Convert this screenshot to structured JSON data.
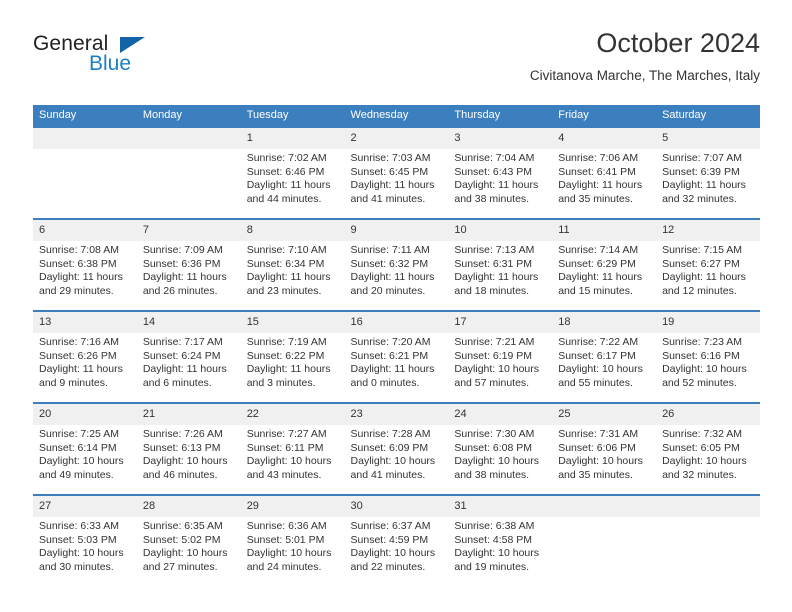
{
  "brand": {
    "name_part1": "General",
    "name_part2": "Blue",
    "accent_color": "#1363a8",
    "text_color": "#231f20"
  },
  "header": {
    "title": "October 2024",
    "subtitle": "Civitanova Marche, The Marches, Italy"
  },
  "calendar": {
    "header_bg": "#3c7fbf",
    "daynum_bg": "#f0f0f0",
    "weekdays": [
      "Sunday",
      "Monday",
      "Tuesday",
      "Wednesday",
      "Thursday",
      "Friday",
      "Saturday"
    ],
    "weeks": [
      [
        {
          "day": "",
          "lines": []
        },
        {
          "day": "",
          "lines": []
        },
        {
          "day": "1",
          "lines": [
            "Sunrise: 7:02 AM",
            "Sunset: 6:46 PM",
            "Daylight: 11 hours",
            "and 44 minutes."
          ]
        },
        {
          "day": "2",
          "lines": [
            "Sunrise: 7:03 AM",
            "Sunset: 6:45 PM",
            "Daylight: 11 hours",
            "and 41 minutes."
          ]
        },
        {
          "day": "3",
          "lines": [
            "Sunrise: 7:04 AM",
            "Sunset: 6:43 PM",
            "Daylight: 11 hours",
            "and 38 minutes."
          ]
        },
        {
          "day": "4",
          "lines": [
            "Sunrise: 7:06 AM",
            "Sunset: 6:41 PM",
            "Daylight: 11 hours",
            "and 35 minutes."
          ]
        },
        {
          "day": "5",
          "lines": [
            "Sunrise: 7:07 AM",
            "Sunset: 6:39 PM",
            "Daylight: 11 hours",
            "and 32 minutes."
          ]
        }
      ],
      [
        {
          "day": "6",
          "lines": [
            "Sunrise: 7:08 AM",
            "Sunset: 6:38 PM",
            "Daylight: 11 hours",
            "and 29 minutes."
          ]
        },
        {
          "day": "7",
          "lines": [
            "Sunrise: 7:09 AM",
            "Sunset: 6:36 PM",
            "Daylight: 11 hours",
            "and 26 minutes."
          ]
        },
        {
          "day": "8",
          "lines": [
            "Sunrise: 7:10 AM",
            "Sunset: 6:34 PM",
            "Daylight: 11 hours",
            "and 23 minutes."
          ]
        },
        {
          "day": "9",
          "lines": [
            "Sunrise: 7:11 AM",
            "Sunset: 6:32 PM",
            "Daylight: 11 hours",
            "and 20 minutes."
          ]
        },
        {
          "day": "10",
          "lines": [
            "Sunrise: 7:13 AM",
            "Sunset: 6:31 PM",
            "Daylight: 11 hours",
            "and 18 minutes."
          ]
        },
        {
          "day": "11",
          "lines": [
            "Sunrise: 7:14 AM",
            "Sunset: 6:29 PM",
            "Daylight: 11 hours",
            "and 15 minutes."
          ]
        },
        {
          "day": "12",
          "lines": [
            "Sunrise: 7:15 AM",
            "Sunset: 6:27 PM",
            "Daylight: 11 hours",
            "and 12 minutes."
          ]
        }
      ],
      [
        {
          "day": "13",
          "lines": [
            "Sunrise: 7:16 AM",
            "Sunset: 6:26 PM",
            "Daylight: 11 hours",
            "and 9 minutes."
          ]
        },
        {
          "day": "14",
          "lines": [
            "Sunrise: 7:17 AM",
            "Sunset: 6:24 PM",
            "Daylight: 11 hours",
            "and 6 minutes."
          ]
        },
        {
          "day": "15",
          "lines": [
            "Sunrise: 7:19 AM",
            "Sunset: 6:22 PM",
            "Daylight: 11 hours",
            "and 3 minutes."
          ]
        },
        {
          "day": "16",
          "lines": [
            "Sunrise: 7:20 AM",
            "Sunset: 6:21 PM",
            "Daylight: 11 hours",
            "and 0 minutes."
          ]
        },
        {
          "day": "17",
          "lines": [
            "Sunrise: 7:21 AM",
            "Sunset: 6:19 PM",
            "Daylight: 10 hours",
            "and 57 minutes."
          ]
        },
        {
          "day": "18",
          "lines": [
            "Sunrise: 7:22 AM",
            "Sunset: 6:17 PM",
            "Daylight: 10 hours",
            "and 55 minutes."
          ]
        },
        {
          "day": "19",
          "lines": [
            "Sunrise: 7:23 AM",
            "Sunset: 6:16 PM",
            "Daylight: 10 hours",
            "and 52 minutes."
          ]
        }
      ],
      [
        {
          "day": "20",
          "lines": [
            "Sunrise: 7:25 AM",
            "Sunset: 6:14 PM",
            "Daylight: 10 hours",
            "and 49 minutes."
          ]
        },
        {
          "day": "21",
          "lines": [
            "Sunrise: 7:26 AM",
            "Sunset: 6:13 PM",
            "Daylight: 10 hours",
            "and 46 minutes."
          ]
        },
        {
          "day": "22",
          "lines": [
            "Sunrise: 7:27 AM",
            "Sunset: 6:11 PM",
            "Daylight: 10 hours",
            "and 43 minutes."
          ]
        },
        {
          "day": "23",
          "lines": [
            "Sunrise: 7:28 AM",
            "Sunset: 6:09 PM",
            "Daylight: 10 hours",
            "and 41 minutes."
          ]
        },
        {
          "day": "24",
          "lines": [
            "Sunrise: 7:30 AM",
            "Sunset: 6:08 PM",
            "Daylight: 10 hours",
            "and 38 minutes."
          ]
        },
        {
          "day": "25",
          "lines": [
            "Sunrise: 7:31 AM",
            "Sunset: 6:06 PM",
            "Daylight: 10 hours",
            "and 35 minutes."
          ]
        },
        {
          "day": "26",
          "lines": [
            "Sunrise: 7:32 AM",
            "Sunset: 6:05 PM",
            "Daylight: 10 hours",
            "and 32 minutes."
          ]
        }
      ],
      [
        {
          "day": "27",
          "lines": [
            "Sunrise: 6:33 AM",
            "Sunset: 5:03 PM",
            "Daylight: 10 hours",
            "and 30 minutes."
          ]
        },
        {
          "day": "28",
          "lines": [
            "Sunrise: 6:35 AM",
            "Sunset: 5:02 PM",
            "Daylight: 10 hours",
            "and 27 minutes."
          ]
        },
        {
          "day": "29",
          "lines": [
            "Sunrise: 6:36 AM",
            "Sunset: 5:01 PM",
            "Daylight: 10 hours",
            "and 24 minutes."
          ]
        },
        {
          "day": "30",
          "lines": [
            "Sunrise: 6:37 AM",
            "Sunset: 4:59 PM",
            "Daylight: 10 hours",
            "and 22 minutes."
          ]
        },
        {
          "day": "31",
          "lines": [
            "Sunrise: 6:38 AM",
            "Sunset: 4:58 PM",
            "Daylight: 10 hours",
            "and 19 minutes."
          ]
        },
        {
          "day": "",
          "lines": []
        },
        {
          "day": "",
          "lines": []
        }
      ]
    ]
  }
}
